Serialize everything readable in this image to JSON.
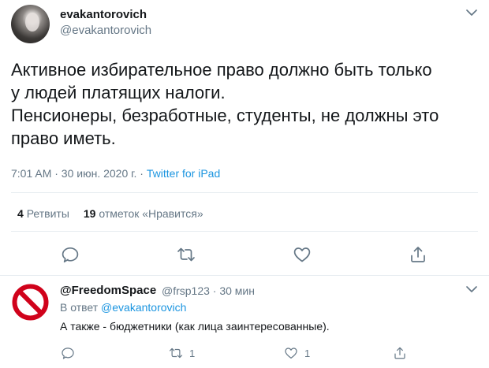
{
  "tweet": {
    "author_name": "evakantorovich",
    "author_handle": "@evakantorovich",
    "text_lines": [
      "Активное избирательное право должно быть только",
      "у людей платящих налоги.",
      "Пенсионеры, безработные, студенты, не должны это",
      "право иметь."
    ],
    "timestamp": "7:01 AM · 30 июн. 2020 г. · ",
    "source": "Twitter for iPad",
    "retweets_count": "4",
    "retweets_label": "Ретвиты",
    "likes_count": "19",
    "likes_label": "отметок «Нравится»",
    "icons": [
      "reply-icon",
      "retweet-icon",
      "like-icon",
      "share-icon",
      "caret-down-icon"
    ]
  },
  "reply": {
    "author_name": "@FreedomSpace",
    "handle_time": "@frsp123 · 30 мин",
    "reply_to_prefix": "В ответ ",
    "reply_to_mention": "@evakantorovich",
    "text": "А также - бюджетники (как лица заинтересованные).",
    "retweets_count": "1",
    "likes_count": "1",
    "icons": [
      "reply-icon",
      "retweet-icon",
      "like-icon",
      "share-icon",
      "prohibited-sign-icon"
    ]
  },
  "colors": {
    "text": "#14171a",
    "secondary": "#657786",
    "link": "#1b95e0",
    "divider": "#e6ecf0",
    "prohibited_red": "#d0021b"
  }
}
